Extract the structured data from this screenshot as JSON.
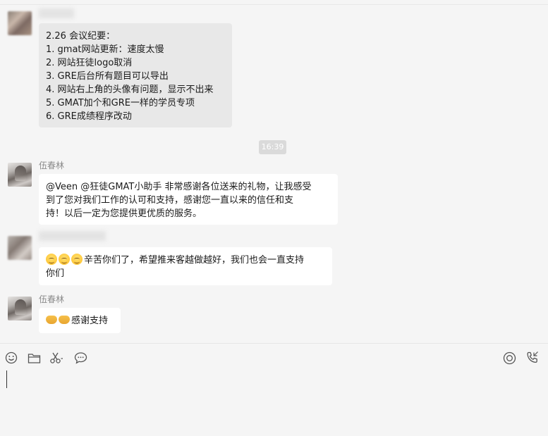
{
  "messages": {
    "m1": {
      "lines": [
        "2.26 会议纪要：",
        "1. gmat网站更新：速度太慢",
        "2. 网站狂徒logo取消",
        "3. GRE后台所有题目可以导出",
        "4. 网站右上角的头像有问题，显示不出来",
        "5. GMAT加个和GRE一样的学员专项",
        "6. GRE成绩程序改动"
      ]
    },
    "timestamp": "16:39",
    "m2": {
      "sender": "伍春林",
      "lines": [
        "@Veen @狂徒GMAT小助手 非常感谢各位送来的礼物，让我感受",
        "到了您对我们工作的认可和支持，感谢您一直以来的信任和支",
        "持！以后一定为您提供更优质的服务。"
      ]
    },
    "m3": {
      "line1": "辛苦你们了，希望推来客越做越好，我们也会一直支持",
      "line2": "你们"
    },
    "m4": {
      "sender": "伍春林",
      "text": "感谢支持"
    }
  },
  "toolbar": {
    "left_icons": [
      "emoji-icon",
      "folder-icon",
      "scissors-icon",
      "chat-bubble-icon"
    ],
    "right_icons": [
      "live-icon",
      "call-icon"
    ]
  },
  "colors": {
    "background": "#f5f5f5",
    "bubble_white": "#ffffff",
    "bubble_gray": "#e8e8e8"
  }
}
